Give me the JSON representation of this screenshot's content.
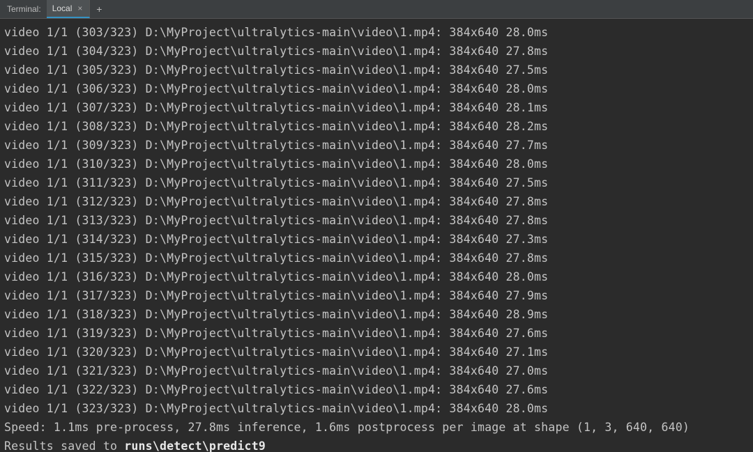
{
  "tabbar": {
    "title_label": "Terminal:",
    "active_tab": "Local",
    "close_glyph": "×",
    "add_glyph": "+"
  },
  "terminal": {
    "video_prefix": "video 1/1",
    "total_frames": 323,
    "path": "D:\\MyProject\\ultralytics-main\\video\\1.mp4:",
    "resolution": "384x640",
    "frames": [
      {
        "n": 303,
        "ms": "28.0ms"
      },
      {
        "n": 304,
        "ms": "27.8ms"
      },
      {
        "n": 305,
        "ms": "27.5ms"
      },
      {
        "n": 306,
        "ms": "28.0ms"
      },
      {
        "n": 307,
        "ms": "28.1ms"
      },
      {
        "n": 308,
        "ms": "28.2ms"
      },
      {
        "n": 309,
        "ms": "27.7ms"
      },
      {
        "n": 310,
        "ms": "28.0ms"
      },
      {
        "n": 311,
        "ms": "27.5ms"
      },
      {
        "n": 312,
        "ms": "27.8ms"
      },
      {
        "n": 313,
        "ms": "27.8ms"
      },
      {
        "n": 314,
        "ms": "27.3ms"
      },
      {
        "n": 315,
        "ms": "27.8ms"
      },
      {
        "n": 316,
        "ms": "28.0ms"
      },
      {
        "n": 317,
        "ms": "27.9ms"
      },
      {
        "n": 318,
        "ms": "28.9ms"
      },
      {
        "n": 319,
        "ms": "27.6ms"
      },
      {
        "n": 320,
        "ms": "27.1ms"
      },
      {
        "n": 321,
        "ms": "27.0ms"
      },
      {
        "n": 322,
        "ms": "27.6ms"
      },
      {
        "n": 323,
        "ms": "28.0ms"
      }
    ],
    "speed_line": "Speed: 1.1ms pre-process, 27.8ms inference, 1.6ms postprocess per image at shape (1, 3, 640, 640)",
    "results_prefix": "Results saved to ",
    "results_path": "runs\\detect\\predict9"
  }
}
